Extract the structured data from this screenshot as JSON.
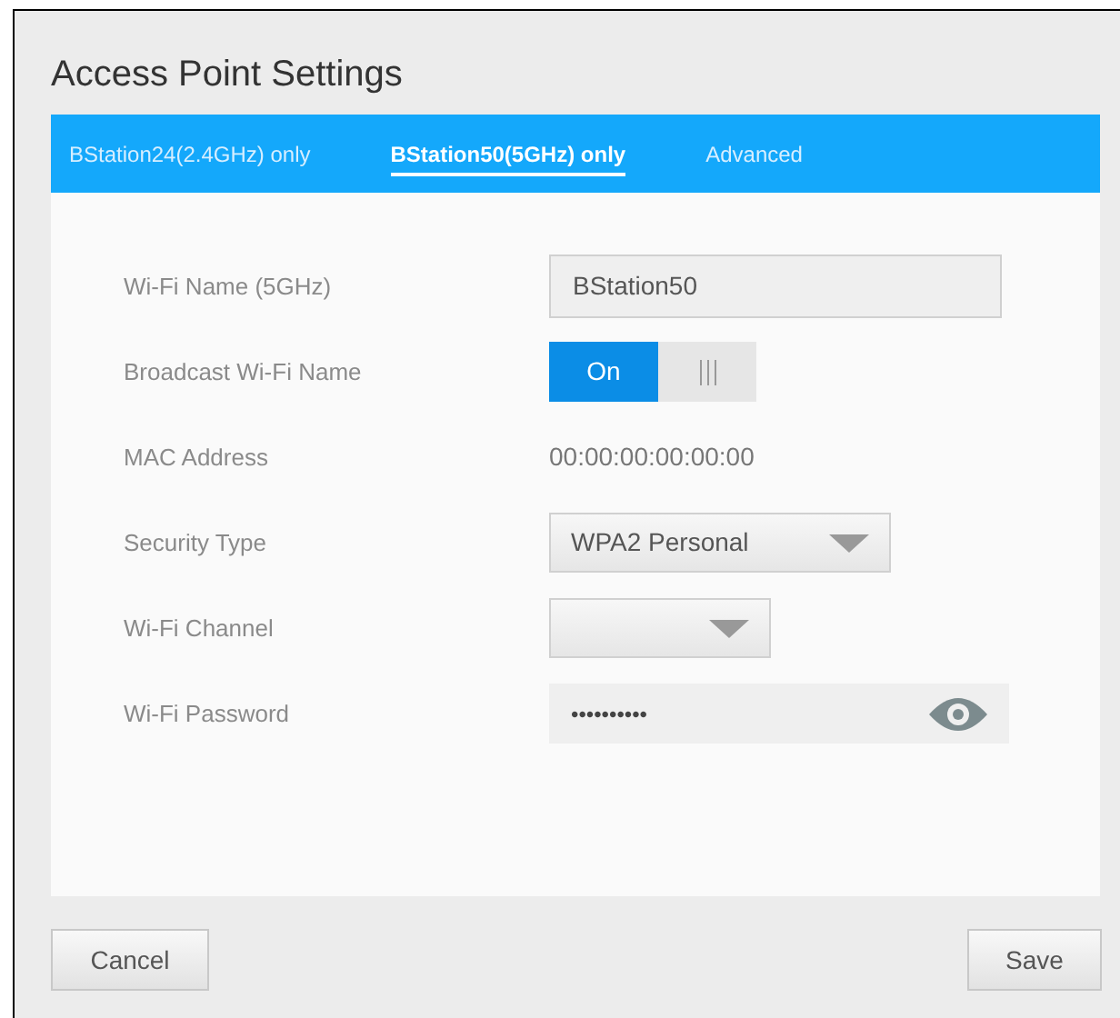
{
  "dialog": {
    "title": "Access Point Settings"
  },
  "tabs": [
    {
      "label": "BStation24(2.4GHz) only",
      "selected": false
    },
    {
      "label": "BStation50(5GHz) only",
      "selected": true
    },
    {
      "label": "Advanced",
      "selected": false
    }
  ],
  "fields": [
    {
      "kind": "text",
      "label": "Wi-Fi Name (5GHz)",
      "value": "BStation50"
    },
    {
      "kind": "toggle",
      "label": "Broadcast Wi-Fi Name",
      "on": true,
      "on_label": "On"
    },
    {
      "kind": "static",
      "label": "MAC Address",
      "value": "00:00:00:00:00:00"
    },
    {
      "kind": "select",
      "label": "Security Type",
      "value": "WPA2 Personal",
      "wide": true
    },
    {
      "kind": "select",
      "label": "Wi-Fi Channel",
      "wide": false
    },
    {
      "kind": "password",
      "label": "Wi-Fi Password",
      "value": "••••••••••"
    }
  ],
  "buttons": [
    "Cancel",
    "Save"
  ]
}
